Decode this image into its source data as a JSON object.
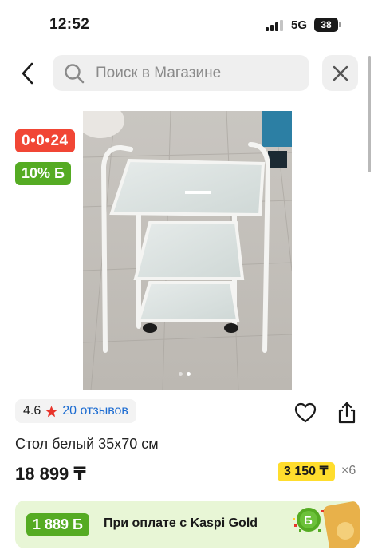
{
  "status_bar": {
    "time": "12:52",
    "network": "5G",
    "battery": "38"
  },
  "top_bar": {
    "search_placeholder": "Поиск в Магазине"
  },
  "badges": {
    "timer": "0•0•24",
    "bonus_percent": "10% Б"
  },
  "product": {
    "rating": "4.6",
    "reviews": "20 отзывов",
    "title": "Стол белый 35х70 см",
    "price": "18 899 ₸",
    "installment_amount": "3 150 ₸",
    "installment_term": "×6"
  },
  "carousel": {
    "dots": 2,
    "active_index": 1
  },
  "kaspi_banner": {
    "bonus": "1 889 Б",
    "text": "При оплате с Kaspi Gold"
  },
  "colors": {
    "timer_red": "#f14635",
    "bonus_green": "#55ab23",
    "link_blue": "#1b6bd1",
    "installment_yellow": "#ffdd2d",
    "banner_bg": "#e8f6d6"
  },
  "icons": {
    "back": "chevron-left-icon",
    "search": "search-icon",
    "close": "close-icon",
    "star": "star-icon",
    "favorite": "heart-icon",
    "share": "share-icon"
  }
}
